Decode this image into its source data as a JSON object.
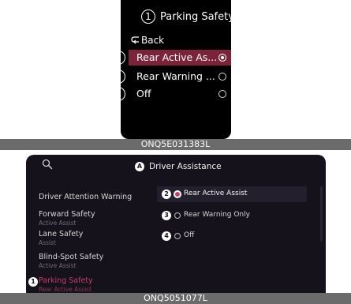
{
  "cluster": {
    "title": "Parking Safety",
    "title_callout": "1",
    "back_label": "Back",
    "options": [
      {
        "callout": "2",
        "label": "Rear Active As...",
        "selected": true
      },
      {
        "callout": "3",
        "label": "Rear Warning ...",
        "selected": false
      },
      {
        "callout": "4",
        "label": "Off",
        "selected": false
      }
    ],
    "caption": "ONQ5E031383L"
  },
  "infotainment": {
    "title_badge": "A",
    "title": "Driver Assistance",
    "menu": [
      {
        "label": "Driver Attention Warning",
        "sub": ""
      },
      {
        "label": "Forward Safety",
        "sub": "Active Assist"
      },
      {
        "label": "Lane Safety",
        "sub": "Assist"
      },
      {
        "label": "Blind-Spot Safety",
        "sub": "Active Assist"
      },
      {
        "label": "Parking Safety",
        "sub": "Rear Active Assist",
        "badge": "1",
        "active": true
      }
    ],
    "options": [
      {
        "badge": "2",
        "label": "Rear Active Assist",
        "selected": true
      },
      {
        "badge": "3",
        "label": "Rear Warning Only",
        "selected": false
      },
      {
        "badge": "4",
        "label": "Off",
        "selected": false
      }
    ],
    "caption": "ONQ5051077L"
  },
  "colors": {
    "accent": "#7b2338",
    "accent_text": "#c83c6a",
    "panel_bg": "#15121c",
    "caption_bg": "#6b6b6b"
  },
  "icons": [
    "search-icon",
    "back-arrow-icon",
    "radio-icon"
  ]
}
